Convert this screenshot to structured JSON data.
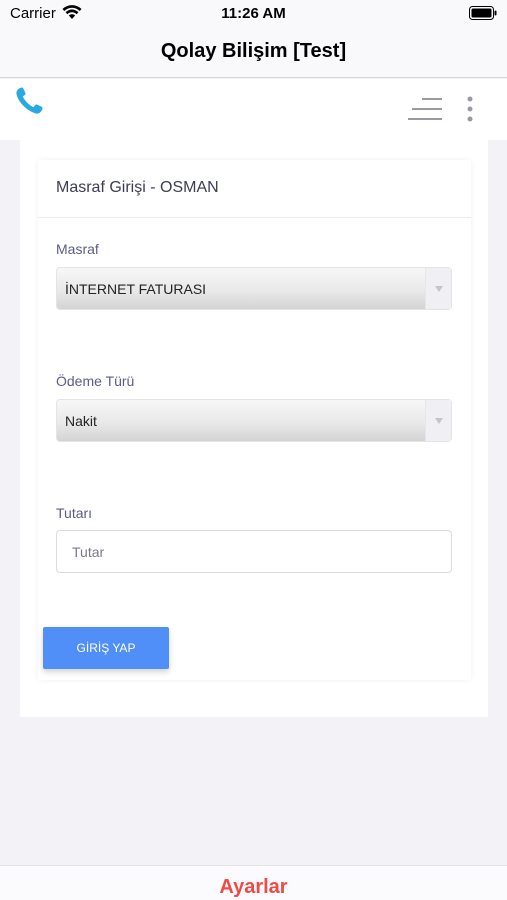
{
  "status_bar": {
    "carrier": "Carrier",
    "time": "11:26 AM"
  },
  "nav": {
    "title": "Qolay Bilişim [Test]"
  },
  "header": {
    "icons": [
      "phone-icon",
      "menu-icon",
      "more-vertical-icon"
    ],
    "accent_color": "#29a9e1"
  },
  "form": {
    "title": "Masraf Girişi - OSMAN",
    "expense_label": "Masraf",
    "expense_value": "İNTERNET FATURASI",
    "payment_label": "Ödeme Türü",
    "payment_value": "Nakit",
    "amount_label": "Tutarı",
    "amount_value": "",
    "amount_placeholder": "Tutar",
    "submit_label": "GİRİŞ YAP",
    "submit_color": "#4f8ff7"
  },
  "tab_bar": {
    "label": "Ayarlar",
    "color": "#f04a44"
  }
}
